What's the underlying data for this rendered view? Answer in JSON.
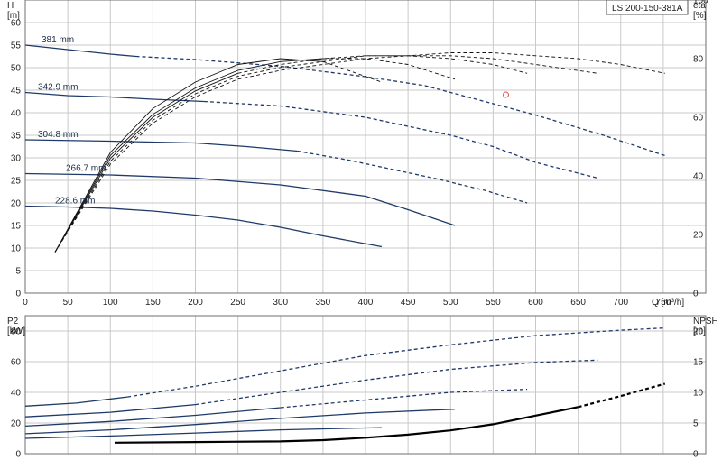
{
  "model_label": "LS 200-150-381A",
  "chart_data": [
    {
      "type": "line",
      "panel": "head",
      "xlabel": "Q [m³/h]",
      "x_ticks": [
        0,
        50,
        100,
        150,
        200,
        250,
        300,
        350,
        400,
        450,
        500,
        550,
        600,
        650,
        700,
        750
      ],
      "xlim": [
        0,
        800
      ],
      "ylabel_left_lines": [
        "H",
        "[m]"
      ],
      "ylim_left": [
        0,
        65
      ],
      "y_ticks_left": [
        0,
        5,
        10,
        15,
        20,
        25,
        30,
        35,
        40,
        45,
        50,
        55,
        60
      ],
      "ylabel_right_lines": [
        "eta",
        "[%]"
      ],
      "ylim_right": [
        0,
        100
      ],
      "y_ticks_right": [
        0,
        20,
        40,
        60,
        80,
        100
      ],
      "grid": true,
      "duty_point": {
        "x": 565,
        "y": 44,
        "color": "#e05050"
      },
      "series": [
        {
          "name": "381 mm",
          "axis": "left",
          "color": "#1f3a68",
          "solid_x": [
            0,
            50,
            100,
            130
          ],
          "solid_y": [
            55,
            54,
            53,
            52.5
          ],
          "dashed_x": [
            130,
            200,
            300,
            400,
            470,
            530,
            600,
            680,
            752
          ],
          "dashed_y": [
            52.5,
            51.8,
            50.3,
            48,
            46,
            43,
            39.5,
            35,
            30.5
          ]
        },
        {
          "name": "342.9 mm",
          "axis": "left",
          "color": "#1f3a68",
          "solid_x": [
            0,
            50,
            100,
            150,
            210
          ],
          "solid_y": [
            44.5,
            43.8,
            43.5,
            43,
            42.5
          ],
          "dashed_x": [
            210,
            300,
            400,
            450,
            500,
            550,
            600,
            673
          ],
          "dashed_y": [
            42.5,
            41.5,
            39,
            37,
            35,
            32.5,
            29,
            25.5
          ]
        },
        {
          "name": "304.8 mm",
          "axis": "left",
          "color": "#1f3a68",
          "solid_x": [
            0,
            100,
            200,
            260,
            320
          ],
          "solid_y": [
            34,
            33.7,
            33.3,
            32.5,
            31.5
          ],
          "dashed_x": [
            320,
            380,
            430,
            480,
            540,
            590
          ],
          "dashed_y": [
            31.5,
            29.5,
            27.5,
            25.5,
            22.8,
            20
          ]
        },
        {
          "name": "266.7 mm",
          "axis": "left",
          "color": "#1f3a68",
          "solid_x": [
            0,
            100,
            200,
            300,
            400,
            450,
            505
          ],
          "solid_y": [
            26.5,
            26.2,
            25.5,
            24,
            21.5,
            18.5,
            15
          ],
          "dashed_x": [],
          "dashed_y": []
        },
        {
          "name": "228.6 mm",
          "axis": "left",
          "color": "#1f3a68",
          "solid_x": [
            0,
            50,
            100,
            150,
            200,
            250,
            300,
            350,
            419
          ],
          "solid_y": [
            19.3,
            19.1,
            18.8,
            18.2,
            17.3,
            16.2,
            14.6,
            12.7,
            10.3
          ],
          "dashed_x": [],
          "dashed_y": []
        },
        {
          "name": "eta 228.6 mm",
          "axis": "right",
          "color": "#111111",
          "solid_x": [
            35,
            100,
            150,
            200,
            250,
            300,
            350
          ],
          "solid_y": [
            14,
            48,
            63,
            72,
            78,
            80,
            79
          ],
          "dashed_x": [
            350,
            419
          ],
          "dashed_y": [
            79,
            72
          ]
        },
        {
          "name": "eta 266.7 mm",
          "axis": "right",
          "color": "#111111",
          "solid_x": [
            35,
            100,
            150,
            200,
            250,
            300,
            350
          ],
          "solid_y": [
            14,
            47,
            61,
            70,
            76,
            79,
            80
          ],
          "dashed_x": [
            350,
            400,
            450,
            505
          ],
          "dashed_y": [
            80,
            80,
            78,
            73
          ]
        },
        {
          "name": "eta 304.8 mm",
          "axis": "right",
          "color": "#111111",
          "solid_x": [
            35,
            100,
            150,
            200,
            250
          ],
          "solid_y": [
            14,
            46,
            60,
            69,
            75
          ],
          "dashed_x": [
            250,
            300,
            350,
            400,
            450,
            500,
            550,
            590
          ],
          "dashed_y": [
            75,
            78,
            80,
            81,
            81,
            80,
            78,
            75
          ]
        },
        {
          "name": "eta 342.9 mm",
          "axis": "right",
          "color": "#111111",
          "solid_x": [],
          "solid_y": [],
          "dashed_x": [
            35,
            100,
            150,
            200,
            250,
            300,
            350,
            400,
            450,
            500,
            550,
            600,
            673
          ],
          "dashed_y": [
            14,
            45,
            59,
            68,
            74,
            77,
            79,
            81,
            81,
            81,
            80,
            78,
            75
          ]
        },
        {
          "name": "eta 381 mm",
          "axis": "right",
          "color": "#111111",
          "solid_x": [],
          "solid_y": [],
          "dashed_x": [
            35,
            100,
            150,
            200,
            250,
            300,
            350,
            400,
            450,
            500,
            550,
            600,
            650,
            700,
            752
          ],
          "dashed_y": [
            14,
            44,
            58,
            67,
            73,
            76,
            78,
            80,
            81,
            82,
            82,
            81,
            80,
            78,
            75
          ]
        }
      ]
    },
    {
      "type": "line",
      "panel": "power",
      "x_ticks": [],
      "xlim": [
        0,
        800
      ],
      "ylabel_left_lines": [
        "P2",
        "[kW]"
      ],
      "ylim_left": [
        0,
        90
      ],
      "y_ticks_left": [
        0,
        20,
        40,
        60,
        80
      ],
      "ylabel_right_lines": [
        "NPSH",
        "[m]"
      ],
      "ylim_right": [
        0,
        22.5
      ],
      "y_ticks_right": [
        0,
        5,
        10,
        15,
        20
      ],
      "grid": true,
      "series": [
        {
          "name": "P2 381 mm",
          "axis": "left",
          "color": "#1f3a68",
          "solid_x": [
            0,
            60,
            120
          ],
          "solid_y": [
            31,
            33,
            37
          ],
          "dashed_x": [
            120,
            200,
            300,
            400,
            500,
            600,
            700,
            752
          ],
          "dashed_y": [
            37,
            44,
            54,
            64,
            71,
            77,
            80.5,
            82
          ]
        },
        {
          "name": "P2 342.9 mm",
          "axis": "left",
          "color": "#1f3a68",
          "solid_x": [
            0,
            100,
            200
          ],
          "solid_y": [
            24,
            27,
            32
          ],
          "dashed_x": [
            200,
            300,
            400,
            500,
            600,
            673
          ],
          "dashed_y": [
            32,
            40,
            48,
            55,
            59.5,
            61
          ]
        },
        {
          "name": "P2 304.8 mm",
          "axis": "left",
          "color": "#1f3a68",
          "solid_x": [
            0,
            100,
            200,
            300
          ],
          "solid_y": [
            18,
            21,
            25,
            30
          ],
          "dashed_x": [
            300,
            400,
            500,
            590
          ],
          "dashed_y": [
            30,
            35,
            40,
            42
          ]
        },
        {
          "name": "P2 266.7 mm",
          "axis": "left",
          "color": "#1f3a68",
          "solid_x": [
            0,
            100,
            200,
            300,
            400,
            505
          ],
          "solid_y": [
            13,
            15.5,
            19,
            23,
            26.5,
            29
          ],
          "dashed_x": [],
          "dashed_y": []
        },
        {
          "name": "P2 228.6 mm",
          "axis": "left",
          "color": "#1f3a68",
          "solid_x": [
            0,
            100,
            200,
            300,
            419
          ],
          "solid_y": [
            10,
            11.5,
            13.5,
            15.5,
            17
          ],
          "dashed_x": [],
          "dashed_y": []
        },
        {
          "name": "NPSH",
          "axis": "right",
          "color": "#000000",
          "width": 2.2,
          "solid_x": [
            105,
            200,
            300,
            350,
            400,
            450,
            500,
            550,
            600,
            650
          ],
          "solid_y": [
            1.8,
            1.9,
            2,
            2.2,
            2.6,
            3.1,
            3.8,
            4.8,
            6.2,
            7.6
          ],
          "dashed_x": [
            650,
            700,
            752
          ],
          "dashed_y": [
            7.6,
            9.4,
            11.4
          ]
        }
      ]
    }
  ]
}
